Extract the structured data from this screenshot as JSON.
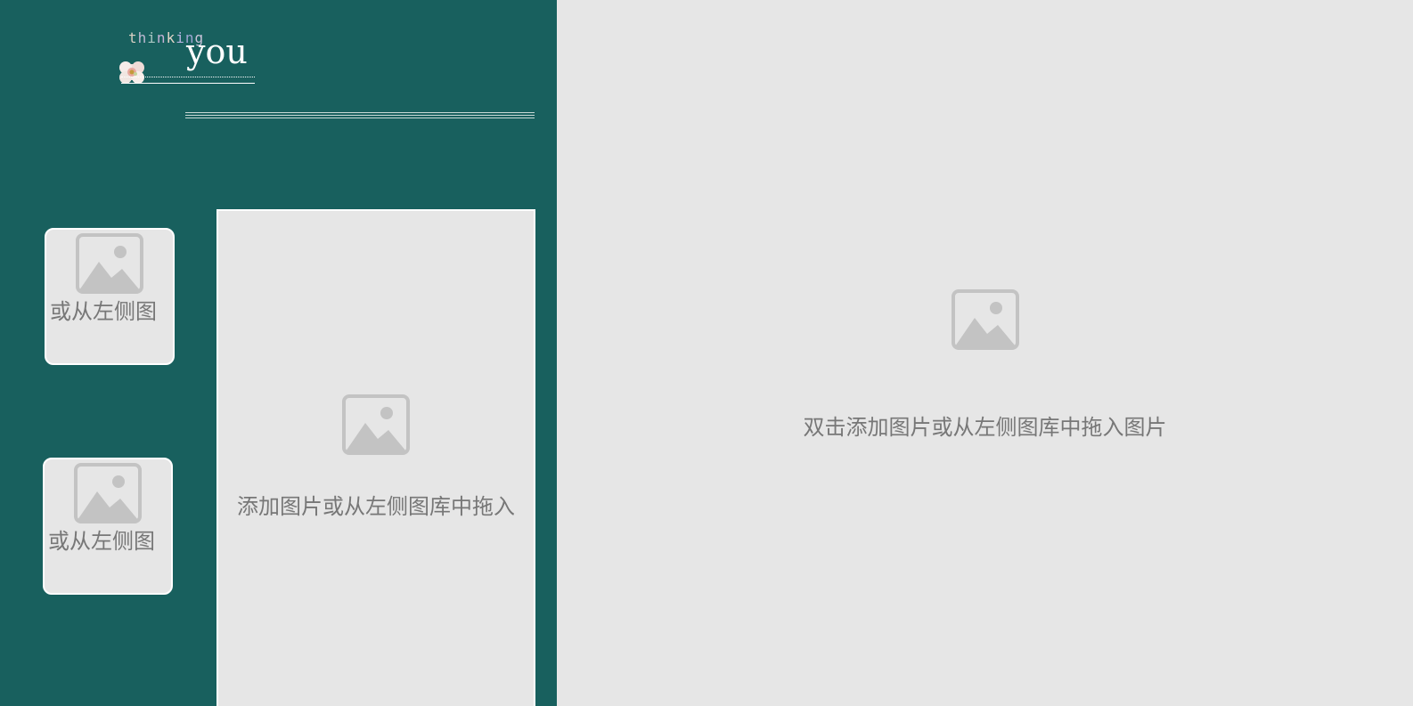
{
  "logo": {
    "thinking_letters": [
      "t",
      "h",
      "i",
      "n",
      "k",
      "i",
      "n",
      "g"
    ],
    "you": "you",
    "flower_icon": "flower-icon"
  },
  "colors": {
    "left_panel_bg": "#18605e",
    "placeholder_bg": "#e6e6e6",
    "placeholder_border": "#ffffff",
    "placeholder_text": "#777777",
    "image_icon": "#c3c3c3"
  },
  "placeholders": {
    "small_1": {
      "text": "或从左侧图",
      "icon": "image-icon"
    },
    "small_2": {
      "text": "或从左侧图",
      "icon": "image-icon"
    },
    "large": {
      "text": "添加图片或从左侧图库中拖入",
      "icon": "image-icon"
    },
    "main": {
      "text": "双击添加图片或从左侧图库中拖入图片",
      "icon": "image-icon"
    }
  }
}
